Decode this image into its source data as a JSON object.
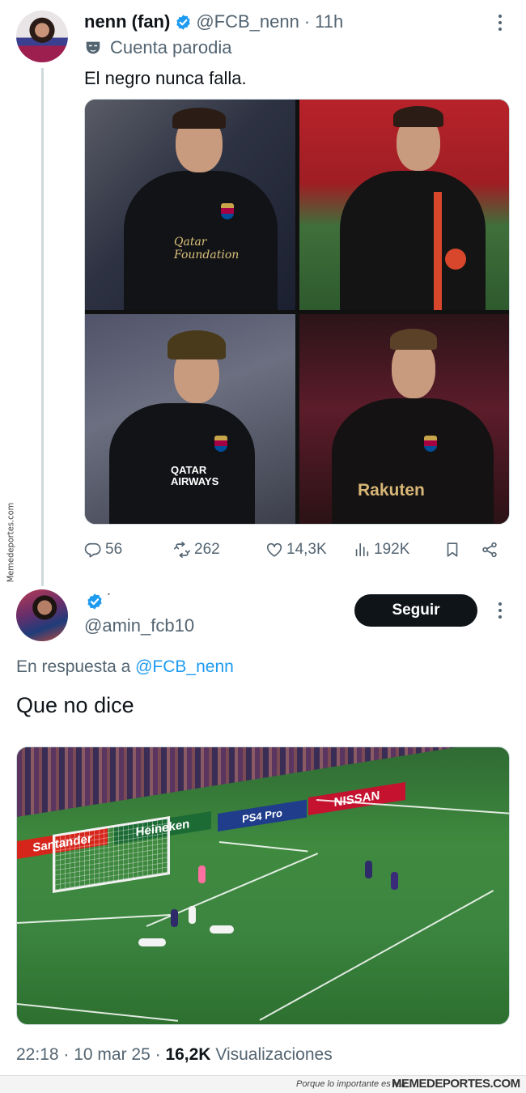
{
  "tweet1": {
    "display_name": "nenn (fan)",
    "handle": "@FCB_nenn",
    "separator": "·",
    "time": "11h",
    "parody_label": "Cuenta parodia",
    "text": "El negro nunca falla.",
    "images": [
      {
        "sponsor": "Qatar Foundation"
      },
      {
        "sponsor": ""
      },
      {
        "sponsor": "QATAR AIRWAYS"
      },
      {
        "sponsor": "Rakuten"
      }
    ],
    "actions": {
      "replies": "56",
      "reposts": "262",
      "likes": "14,3K",
      "views": "192K"
    }
  },
  "tweet2": {
    "display_name_mark": "ˊ",
    "handle": "@amin_fcb10",
    "follow_label": "Seguir",
    "reply_prefix": "En respuesta a",
    "reply_mention": "@FCB_nenn",
    "text": "Que no dice",
    "video_boards": [
      "NISSAN",
      "PS4 Pro",
      "Heineken",
      "Santander"
    ],
    "timestamp": "22:18 · 10 mar 25 ·",
    "views_count": "16,2K",
    "views_label": "Visualizaciones"
  },
  "watermark": {
    "side": "Memedeportes.com",
    "tagline": "Porque lo importante es reír",
    "brand": "MEMEDEPORTES.COM"
  },
  "colors": {
    "text_primary": "#0f1419",
    "text_secondary": "#536471",
    "accent_blue": "#1d9bf0",
    "button_dark": "#0f1419"
  },
  "icons": {
    "verified": "verified-badge-icon",
    "parody": "parody-mask-icon",
    "reply": "reply-icon",
    "repost": "repost-icon",
    "like": "heart-icon",
    "views": "views-chart-icon",
    "bookmark": "bookmark-icon",
    "share": "share-icon",
    "more": "more-options-icon"
  }
}
